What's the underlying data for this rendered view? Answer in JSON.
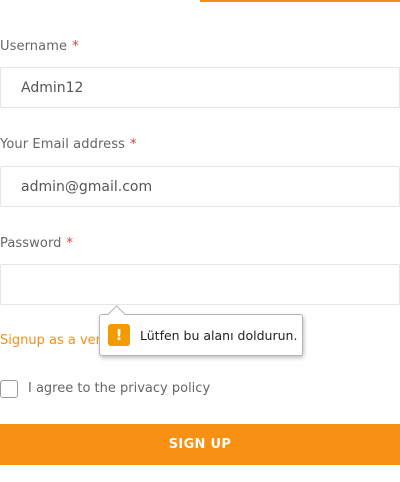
{
  "form": {
    "username": {
      "label": "Username",
      "required_mark": "*",
      "value": "Admin12"
    },
    "email": {
      "label": "Your Email address",
      "required_mark": "*",
      "value": "admin@gmail.com"
    },
    "password": {
      "label": "Password",
      "required_mark": "*",
      "value": ""
    },
    "signup_vendor_link": "Signup as a vendor?",
    "privacy_label": "I agree to the privacy policy",
    "submit_label": "SIGN UP"
  },
  "validation_tooltip": {
    "icon": "warning-icon",
    "icon_glyph": "!",
    "message": "Lütfen bu alanı doldurun."
  },
  "colors": {
    "accent": "#f39019",
    "required": "#e53935",
    "warning": "#f29b00"
  }
}
